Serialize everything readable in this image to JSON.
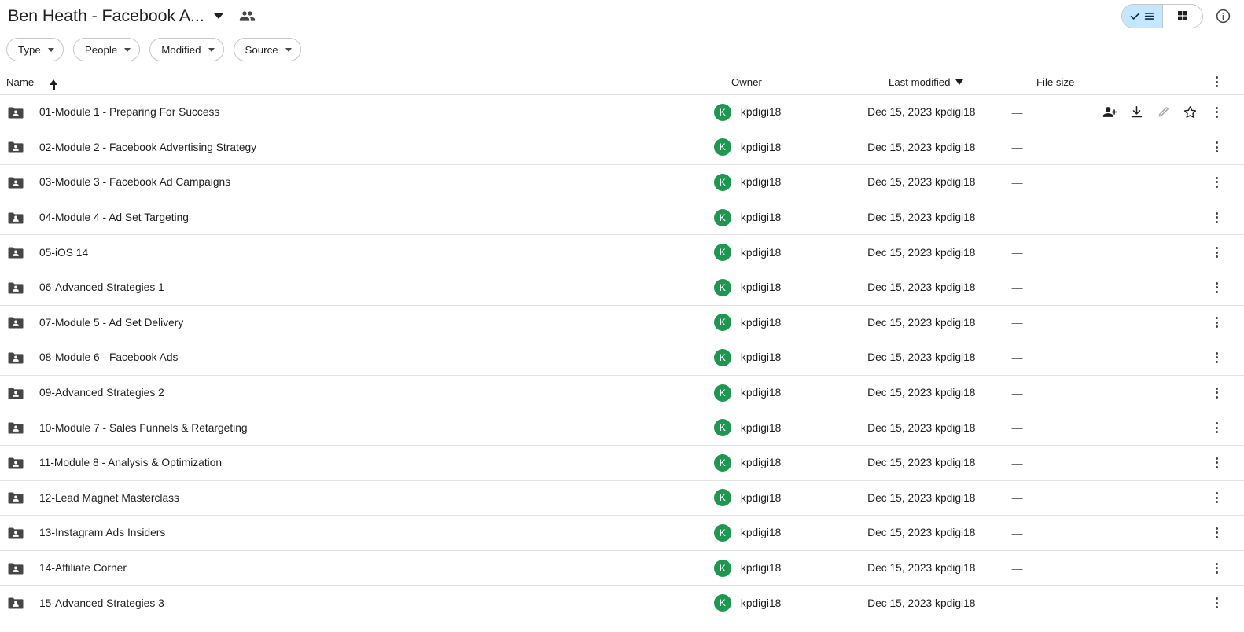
{
  "header": {
    "title": "Ben Heath - Facebook A...",
    "title_caret_icon": "chevron-down-icon",
    "shared_icon": "people-shared-icon",
    "view_toggle": {
      "list_label": "",
      "list_icon": "list-view-icon",
      "grid_icon": "grid-view-icon",
      "active": "list"
    },
    "info_icon": "info-circle-icon"
  },
  "filters": [
    {
      "label": "Type"
    },
    {
      "label": "People"
    },
    {
      "label": "Modified"
    },
    {
      "label": "Source"
    }
  ],
  "columns": {
    "name": "Name",
    "name_sort": "ascending",
    "owner": "Owner",
    "last_modified": "Last modified",
    "last_modified_sort": "descending",
    "file_size": "File size",
    "options_icon": "more-options-icon"
  },
  "row_actions": {
    "share": "share-person-add-icon",
    "download": "download-icon",
    "edit": "edit-pencil-icon",
    "star": "star-icon",
    "more": "more-options-icon"
  },
  "rows": [
    {
      "name": "01-Module 1 - Preparing For Success",
      "icon": "shared-folder-icon",
      "owner": "kpdigi18",
      "owner_initial": "K",
      "modified": "Dec 15, 2023 kpdigi18",
      "size": "—",
      "hovered": true
    },
    {
      "name": "02-Module 2 - Facebook Advertising Strategy",
      "icon": "shared-folder-icon",
      "owner": "kpdigi18",
      "owner_initial": "K",
      "modified": "Dec 15, 2023 kpdigi18",
      "size": "—",
      "hovered": false
    },
    {
      "name": "03-Module 3 - Facebook Ad Campaigns",
      "icon": "shared-folder-icon",
      "owner": "kpdigi18",
      "owner_initial": "K",
      "modified": "Dec 15, 2023 kpdigi18",
      "size": "—",
      "hovered": false
    },
    {
      "name": "04-Module 4 - Ad Set Targeting",
      "icon": "shared-folder-icon",
      "owner": "kpdigi18",
      "owner_initial": "K",
      "modified": "Dec 15, 2023 kpdigi18",
      "size": "—",
      "hovered": false
    },
    {
      "name": "05-iOS 14",
      "icon": "shared-folder-icon",
      "owner": "kpdigi18",
      "owner_initial": "K",
      "modified": "Dec 15, 2023 kpdigi18",
      "size": "—",
      "hovered": false
    },
    {
      "name": "06-Advanced Strategies 1",
      "icon": "shared-folder-icon",
      "owner": "kpdigi18",
      "owner_initial": "K",
      "modified": "Dec 15, 2023 kpdigi18",
      "size": "—",
      "hovered": false
    },
    {
      "name": "07-Module 5 - Ad Set Delivery",
      "icon": "shared-folder-icon",
      "owner": "kpdigi18",
      "owner_initial": "K",
      "modified": "Dec 15, 2023 kpdigi18",
      "size": "—",
      "hovered": false
    },
    {
      "name": "08-Module 6 - Facebook Ads",
      "icon": "shared-folder-icon",
      "owner": "kpdigi18",
      "owner_initial": "K",
      "modified": "Dec 15, 2023 kpdigi18",
      "size": "—",
      "hovered": false
    },
    {
      "name": "09-Advanced Strategies 2",
      "icon": "shared-folder-icon",
      "owner": "kpdigi18",
      "owner_initial": "K",
      "modified": "Dec 15, 2023 kpdigi18",
      "size": "—",
      "hovered": false
    },
    {
      "name": "10-Module 7 - Sales Funnels & Retargeting",
      "icon": "shared-folder-icon",
      "owner": "kpdigi18",
      "owner_initial": "K",
      "modified": "Dec 15, 2023 kpdigi18",
      "size": "—",
      "hovered": false
    },
    {
      "name": "11-Module 8 - Analysis & Optimization",
      "icon": "shared-folder-icon",
      "owner": "kpdigi18",
      "owner_initial": "K",
      "modified": "Dec 15, 2023 kpdigi18",
      "size": "—",
      "hovered": false
    },
    {
      "name": "12-Lead Magnet Masterclass",
      "icon": "shared-folder-icon",
      "owner": "kpdigi18",
      "owner_initial": "K",
      "modified": "Dec 15, 2023 kpdigi18",
      "size": "—",
      "hovered": false
    },
    {
      "name": "13-Instagram Ads Insiders",
      "icon": "shared-folder-icon",
      "owner": "kpdigi18",
      "owner_initial": "K",
      "modified": "Dec 15, 2023 kpdigi18",
      "size": "—",
      "hovered": false
    },
    {
      "name": "14-Affiliate Corner",
      "icon": "shared-folder-icon",
      "owner": "kpdigi18",
      "owner_initial": "K",
      "modified": "Dec 15, 2023 kpdigi18",
      "size": "—",
      "hovered": false
    },
    {
      "name": "15-Advanced Strategies 3",
      "icon": "shared-folder-icon",
      "owner": "kpdigi18",
      "owner_initial": "K",
      "modified": "Dec 15, 2023 kpdigi18",
      "size": "—",
      "hovered": false
    }
  ],
  "colors": {
    "accent_selected": "#c2e7ff",
    "avatar_green": "#1e9751",
    "folder_gray": "#444746",
    "border": "#e3e3e3"
  }
}
